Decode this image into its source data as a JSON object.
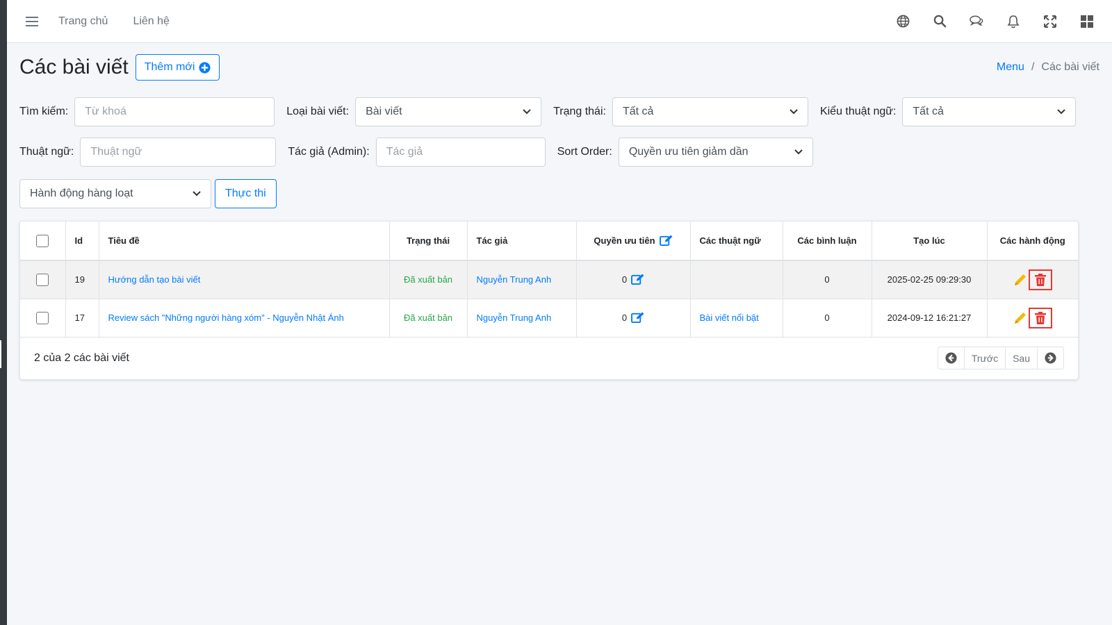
{
  "navbar": {
    "links": [
      "Trang chủ",
      "Liên hệ"
    ],
    "icons": [
      "globe-icon",
      "search-icon",
      "chat-icon",
      "bell-icon",
      "fullscreen-icon",
      "grid-icon"
    ]
  },
  "header": {
    "title": "Các bài viết",
    "add_button": "Thêm mới",
    "breadcrumb_root": "Menu",
    "breadcrumb_sep": "/",
    "breadcrumb_current": "Các bài viết"
  },
  "filters": {
    "search_label": "Tìm kiếm:",
    "search_placeholder": "Từ khoá",
    "type_label": "Loại bài viết:",
    "type_value": "Bài viết",
    "status_label": "Trạng thái:",
    "status_value": "Tất cả",
    "term_type_label": "Kiểu thuật ngữ:",
    "term_type_value": "Tất cả",
    "term_label": "Thuật ngữ:",
    "term_placeholder": "Thuật ngữ",
    "author_label": "Tác giả (Admin):",
    "author_placeholder": "Tác giả",
    "sort_label": "Sort Order:",
    "sort_value": "Quyền ưu tiên giảm dần"
  },
  "bulk": {
    "select_value": "Hành động hàng loạt",
    "exec_button": "Thực thi"
  },
  "table": {
    "headers": {
      "id": "Id",
      "title": "Tiêu đề",
      "status": "Trạng thái",
      "author": "Tác giả",
      "priority": "Quyền ưu tiên",
      "terms": "Các thuật ngữ",
      "comments": "Các bình luận",
      "created": "Tạo lúc",
      "actions": "Các hành động"
    },
    "rows": [
      {
        "id": "19",
        "title": "Hướng dẫn tạo bài viết",
        "status": "Đã xuất bản",
        "author": "Nguyễn Trung Anh",
        "priority": "0",
        "terms": "",
        "comments": "0",
        "created": "2025-02-25 09:29:30"
      },
      {
        "id": "17",
        "title": "Review sách \"Những người hàng xóm\" - Nguyễn Nhật Ánh",
        "status": "Đã xuất bản",
        "author": "Nguyễn Trung Anh",
        "priority": "0",
        "terms": "Bài viết nổi bật",
        "comments": "0",
        "created": "2024-09-12 16:21:27"
      }
    ]
  },
  "footer": {
    "count_text": "2 của 2 các bài viết",
    "prev": "Trước",
    "next": "Sau"
  },
  "colors": {
    "primary": "#007bff",
    "success": "#28a745",
    "danger": "#e53935",
    "warning": "#f5b800"
  }
}
